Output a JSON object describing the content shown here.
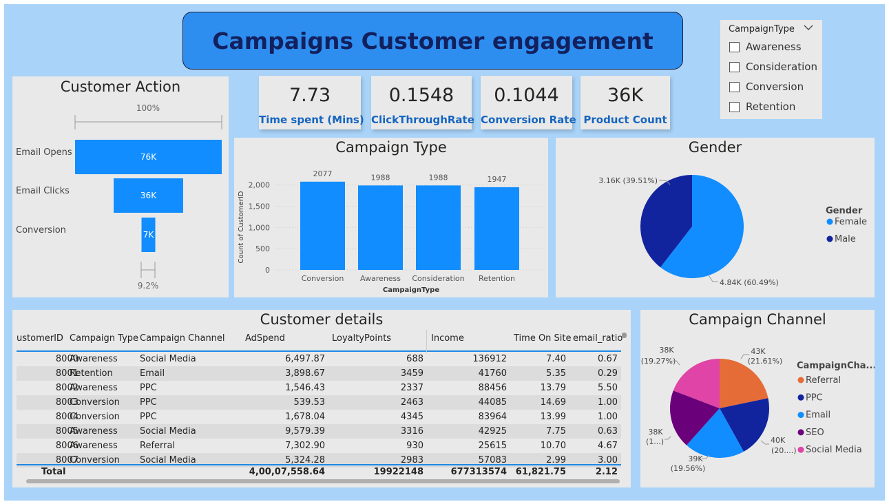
{
  "title": "Campaigns Customer engagement",
  "slicer": {
    "header": "CampaignType",
    "options": [
      "Awareness",
      "Consideration",
      "Conversion",
      "Retention"
    ]
  },
  "kpis": [
    {
      "value": "7.73",
      "label": "Time spent (Mins)"
    },
    {
      "value": "0.1548",
      "label": "ClickThroughRate"
    },
    {
      "value": "0.1044",
      "label": "Conversion Rate"
    },
    {
      "value": "36K",
      "label": "Product Count"
    }
  ],
  "funnel": {
    "title": "Customer Action",
    "top_pct": "100%",
    "bottom_pct": "9.2%",
    "stages": [
      {
        "label": "Email Opens",
        "value_label": "76K",
        "value": 76000
      },
      {
        "label": "Email Clicks",
        "value_label": "36K",
        "value": 36000
      },
      {
        "label": "Conversion",
        "value_label": "7K",
        "value": 7000
      }
    ]
  },
  "campaign_type_chart": {
    "title": "Campaign Type",
    "xlabel": "CampaignType",
    "ylabel": "Count of CustomerID",
    "yticks": [
      "0",
      "500",
      "1,000",
      "1,500",
      "2,000"
    ]
  },
  "gender_chart": {
    "title": "Gender",
    "legend_title": "Gender",
    "slice_labels": [
      "4.84K (60.49%)",
      "3.16K (39.51%)"
    ]
  },
  "channel_chart": {
    "title": "Campaign Channel",
    "legend_title": "CampaignCha...",
    "slice_labels": [
      [
        "43K",
        "(21.61%)"
      ],
      [
        "40K",
        "(20....)"
      ],
      [
        "39K",
        "(19.56%)"
      ],
      [
        "38K",
        "(1...)"
      ],
      [
        "38K",
        "(19.27%)"
      ]
    ]
  },
  "chart_data": [
    {
      "type": "bar",
      "title": "Customer Action",
      "categories": [
        "Email Opens",
        "Email Clicks",
        "Conversion"
      ],
      "values": [
        76000,
        36000,
        7000
      ]
    },
    {
      "type": "bar",
      "title": "Campaign Type",
      "categories": [
        "Conversion",
        "Awareness",
        "Consideration",
        "Retention"
      ],
      "values": [
        2077,
        1988,
        1988,
        1947
      ],
      "xlabel": "CampaignType",
      "ylabel": "Count of CustomerID",
      "ylim": [
        0,
        2200
      ],
      "color": "#118dff"
    },
    {
      "type": "pie",
      "title": "Gender",
      "categories": [
        "Female",
        "Male"
      ],
      "values": [
        4840,
        3160
      ],
      "percent": [
        60.49,
        39.51
      ],
      "colors": [
        "#118dff",
        "#12239e"
      ]
    },
    {
      "type": "pie",
      "title": "Campaign Channel",
      "categories": [
        "Referral",
        "PPC",
        "Email",
        "SEO",
        "Social Media"
      ],
      "values": [
        43000,
        40000,
        39000,
        38000,
        38000
      ],
      "percent": [
        21.61,
        20.3,
        19.56,
        19.26,
        19.27
      ],
      "colors": [
        "#e66c37",
        "#12239e",
        "#118dff",
        "#6b007b",
        "#e044a7"
      ]
    }
  ],
  "table": {
    "title": "Customer details",
    "columns": [
      "ustomerID",
      "Campaign Type",
      "Campaign Channel",
      "AdSpend",
      "LoyaltyPoints",
      "Income",
      "Time On Site",
      "email_ratio"
    ],
    "rows": [
      [
        "8000",
        "Awareness",
        "Social Media",
        "6,497.87",
        "688",
        "136912",
        "7.40",
        "0.67"
      ],
      [
        "8001",
        "Retention",
        "Email",
        "3,898.67",
        "3459",
        "41760",
        "5.35",
        "0.29"
      ],
      [
        "8002",
        "Awareness",
        "PPC",
        "1,546.43",
        "2337",
        "88456",
        "13.79",
        "5.50"
      ],
      [
        "8003",
        "Conversion",
        "PPC",
        "539.53",
        "2463",
        "44085",
        "14.69",
        "1.00"
      ],
      [
        "8004",
        "Conversion",
        "PPC",
        "1,678.04",
        "4345",
        "83964",
        "13.99",
        "1.00"
      ],
      [
        "8005",
        "Awareness",
        "Social Media",
        "9,579.39",
        "3316",
        "42925",
        "7.75",
        "0.63"
      ],
      [
        "8006",
        "Awareness",
        "Referral",
        "7,302.90",
        "930",
        "25615",
        "10.70",
        "4.67"
      ],
      [
        "8007",
        "Conversion",
        "Social Media",
        "5,324.28",
        "2983",
        "57083",
        "2.99",
        "3.00"
      ]
    ],
    "total": [
      "Total",
      "4,00,07,558.64",
      "19922148",
      "677313574",
      "61,821.75",
      "2.12"
    ]
  }
}
